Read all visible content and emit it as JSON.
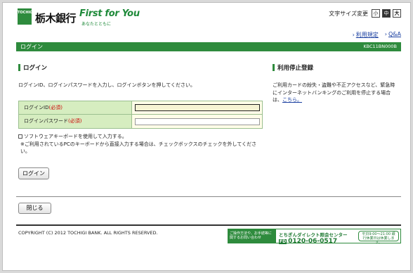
{
  "header": {
    "logo_text": "TOCHIGI",
    "bank_name": "栃木銀行",
    "tagline_main": "First for You",
    "tagline_sub": "あなたとともに",
    "font_size_label": "文字サイズ変更",
    "font_size_small": "小",
    "font_size_mid": "中",
    "font_size_large": "大",
    "links": [
      {
        "label": "利用規定"
      },
      {
        "label": "Q&A"
      }
    ]
  },
  "titlebar": {
    "title": "ログイン",
    "code": "KBC11BN000B"
  },
  "login": {
    "heading": "ログイン",
    "instruction": "ログインID、ログインパスワードを入力し、ログインボタンを押してください。",
    "id_label": "ログインID",
    "password_label": "ログインパスワード",
    "required_mark": "(必須)",
    "id_value": "",
    "password_value": "",
    "software_keyboard_label": "ソフトウェアキーボードを使用して入力する。",
    "note": "※ご利用されているPCのキーボードから直接入力する場合は、チェックボックスのチェックを外してください。",
    "login_button": "ログイン"
  },
  "suspend": {
    "heading": "利用停止登録",
    "text": "ご利用カードの紛失・盗難や不正アクセスなど、緊急時にインターネットバンキングのご利用を停止する場合は、",
    "link": "こちら。"
  },
  "footer": {
    "close_button": "閉じる",
    "copyright": "COPYRIGHT (C) 2012 TOCHIGI BANK. ALL RIGHTS RESERVED.",
    "contact_left": "ご操作方法や、お手続等に関するお問い合わせ",
    "contact_title": "とちぎんダイレクト照会センター",
    "contact_fd": "FD",
    "contact_tel": "0120-06-0517",
    "contact_hours": "平日9:00〜21:00 銀行休業日は休業します。"
  },
  "colors": {
    "brand_green": "#2e8b3d",
    "label_bg": "#d6edc0",
    "input_bg": "#fffde8",
    "required_red": "#cc0000",
    "link_blue": "#1a3fa0"
  }
}
